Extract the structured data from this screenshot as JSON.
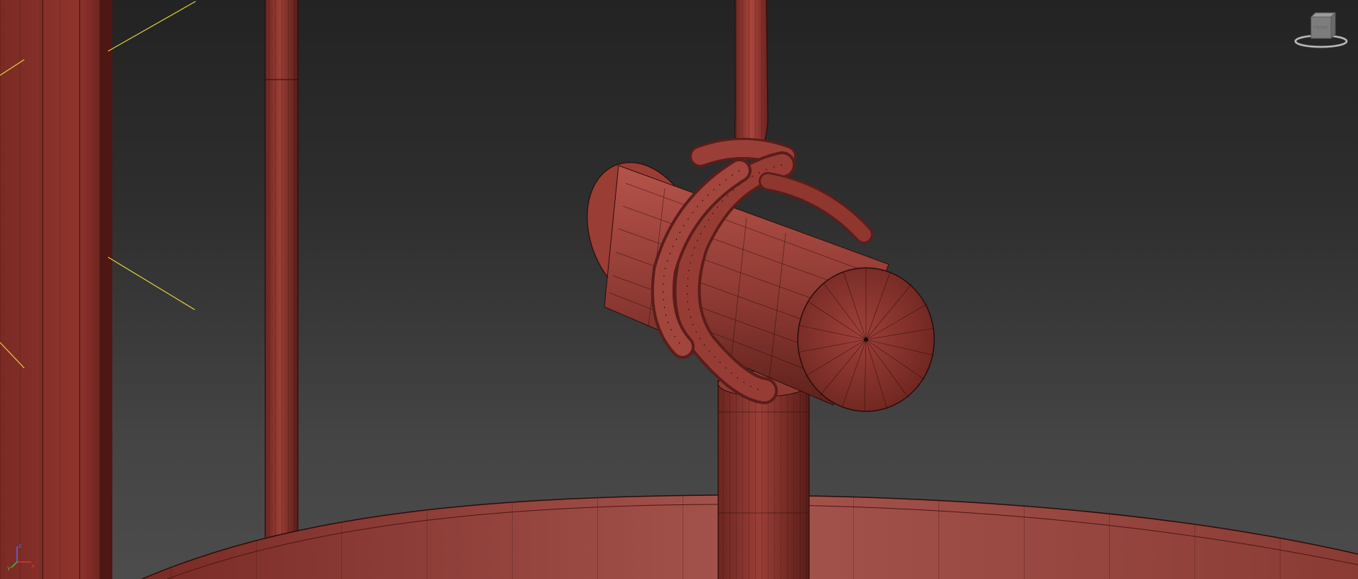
{
  "viewport": {
    "background_top": "#232323",
    "background_bottom": "#4c4c4c"
  },
  "scene": {
    "mesh_color": "#8a3a33",
    "mesh_shadow": "#5a1e1a",
    "mesh_highlight": "#b2554b",
    "wire_color": "#2a0c0a",
    "guide_color": "#e6d23a"
  },
  "navcube": {
    "icon": "viewcube-icon",
    "face_label": "FRONT"
  },
  "axis_tripod": {
    "icon": "axis-tripod-icon",
    "x_label": "x",
    "y_label": "y",
    "z_label": "z",
    "x_color": "#d23a3a",
    "y_color": "#3ac23a",
    "z_color": "#4a6cff"
  }
}
